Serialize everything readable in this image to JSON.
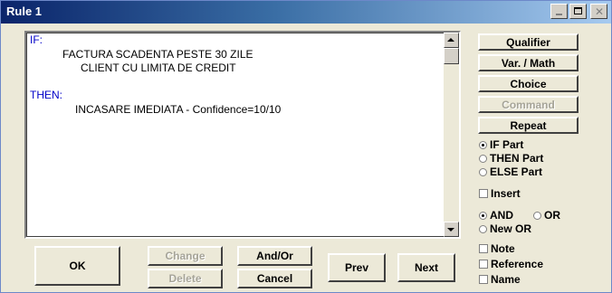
{
  "window": {
    "title": "Rule 1"
  },
  "rule_text": {
    "if_label": "IF:",
    "conditions": [
      "FACTURA SCADENTA PESTE 30 ZILE",
      "CLIENT CU LIMITA DE CREDIT"
    ],
    "then_label": "THEN:",
    "actions": [
      "INCASARE IMEDIATA - Confidence=10/10"
    ]
  },
  "side_buttons": {
    "qualifier": "Qualifier",
    "var_math": "Var. / Math",
    "choice": "Choice",
    "command": "Command",
    "repeat": "Repeat"
  },
  "part_options": {
    "if_part": "IF Part",
    "then_part": "THEN Part",
    "else_part": "ELSE Part",
    "selected": "IF Part"
  },
  "insert_label": "Insert",
  "logic_options": {
    "and": "AND",
    "or": "OR",
    "new_or": "New OR",
    "selected": "AND"
  },
  "extra_options": {
    "note": "Note",
    "reference": "Reference",
    "name": "Name"
  },
  "bottom_buttons": {
    "ok": "OK",
    "change": "Change",
    "delete": "Delete",
    "and_or": "And/Or",
    "cancel": "Cancel",
    "prev": "Prev",
    "next": "Next"
  },
  "colors": {
    "keyword": "#0000c8",
    "disabled_text": "#a6a498",
    "title_gradient_start": "#0a246a"
  }
}
